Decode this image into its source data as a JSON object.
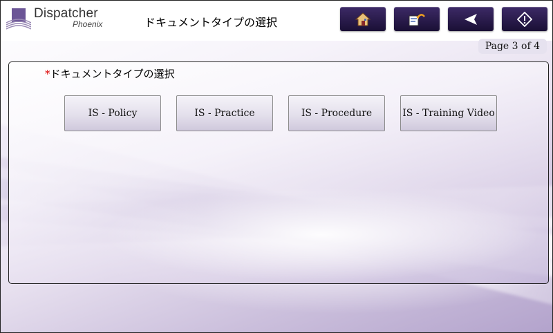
{
  "header": {
    "logo_name": "Dispatcher",
    "logo_sub": "Phoenix",
    "title": "ドキュメントタイプの選択"
  },
  "nav": [
    {
      "icon": "home-icon"
    },
    {
      "icon": "edit-undo-icon"
    },
    {
      "icon": "back-arrow-icon"
    },
    {
      "icon": "next-diamond-icon"
    }
  ],
  "page_indicator": "Page 3 of 4",
  "field": {
    "required_marker": "*",
    "label": "ドキュメントタイプの選択",
    "options": [
      "IS - Policy",
      "IS - Practice",
      "IS - Procedure",
      "IS - Training Video"
    ]
  },
  "colors": {
    "nav_button": "#2a1b4d",
    "accent": "#6b5596",
    "required": "#dd0000"
  }
}
